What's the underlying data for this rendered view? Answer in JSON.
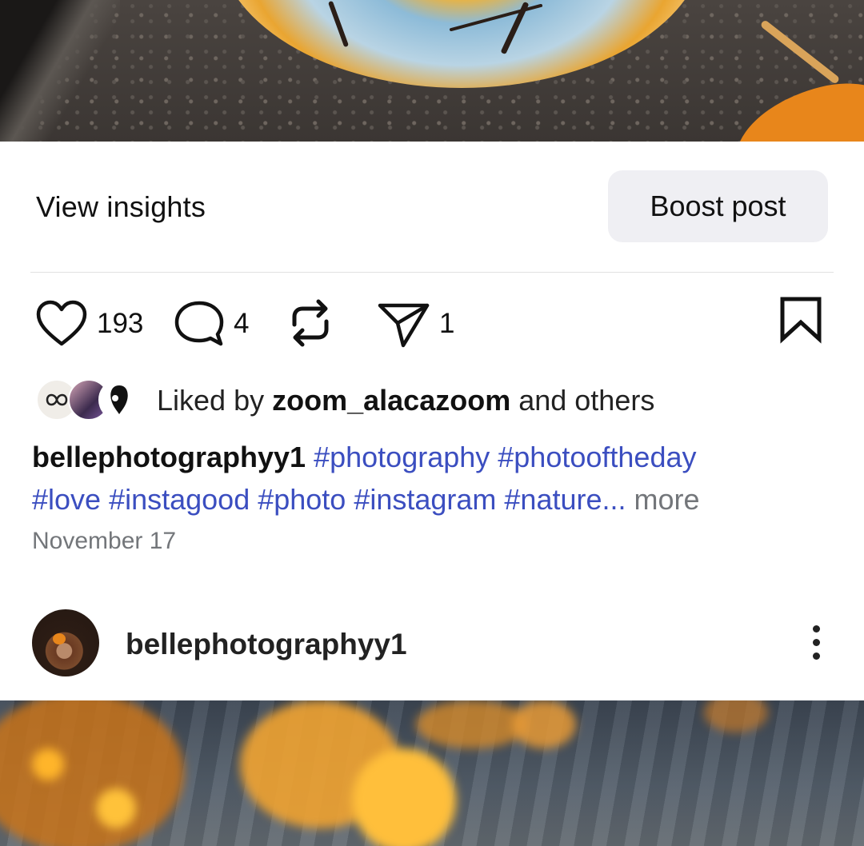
{
  "post": {
    "view_insights_label": "View insights",
    "boost_label": "Boost post",
    "likes_count": "193",
    "comments_count": "4",
    "shares_count": "1",
    "liked_by_prefix": "Liked by",
    "liked_by_user": "zoom_alacazoom",
    "liked_by_suffix": "and others",
    "caption_user": "bellephotographyy1",
    "caption_tags_line1": "#photography #photooftheday",
    "caption_tags_line2": "#love #instagood #photo #instagram #nature...",
    "caption_more": "more",
    "date": "November 17"
  },
  "next_post": {
    "username": "bellephotographyy1"
  },
  "icons": {
    "like": "heart-icon",
    "comment": "comment-icon",
    "repost": "repost-icon",
    "share": "send-icon",
    "save": "bookmark-icon",
    "options": "more-vertical-icon"
  },
  "colors": {
    "hashtag": "#3b4ec0",
    "secondary_text": "#73767a",
    "boost_bg": "#efeff3"
  }
}
